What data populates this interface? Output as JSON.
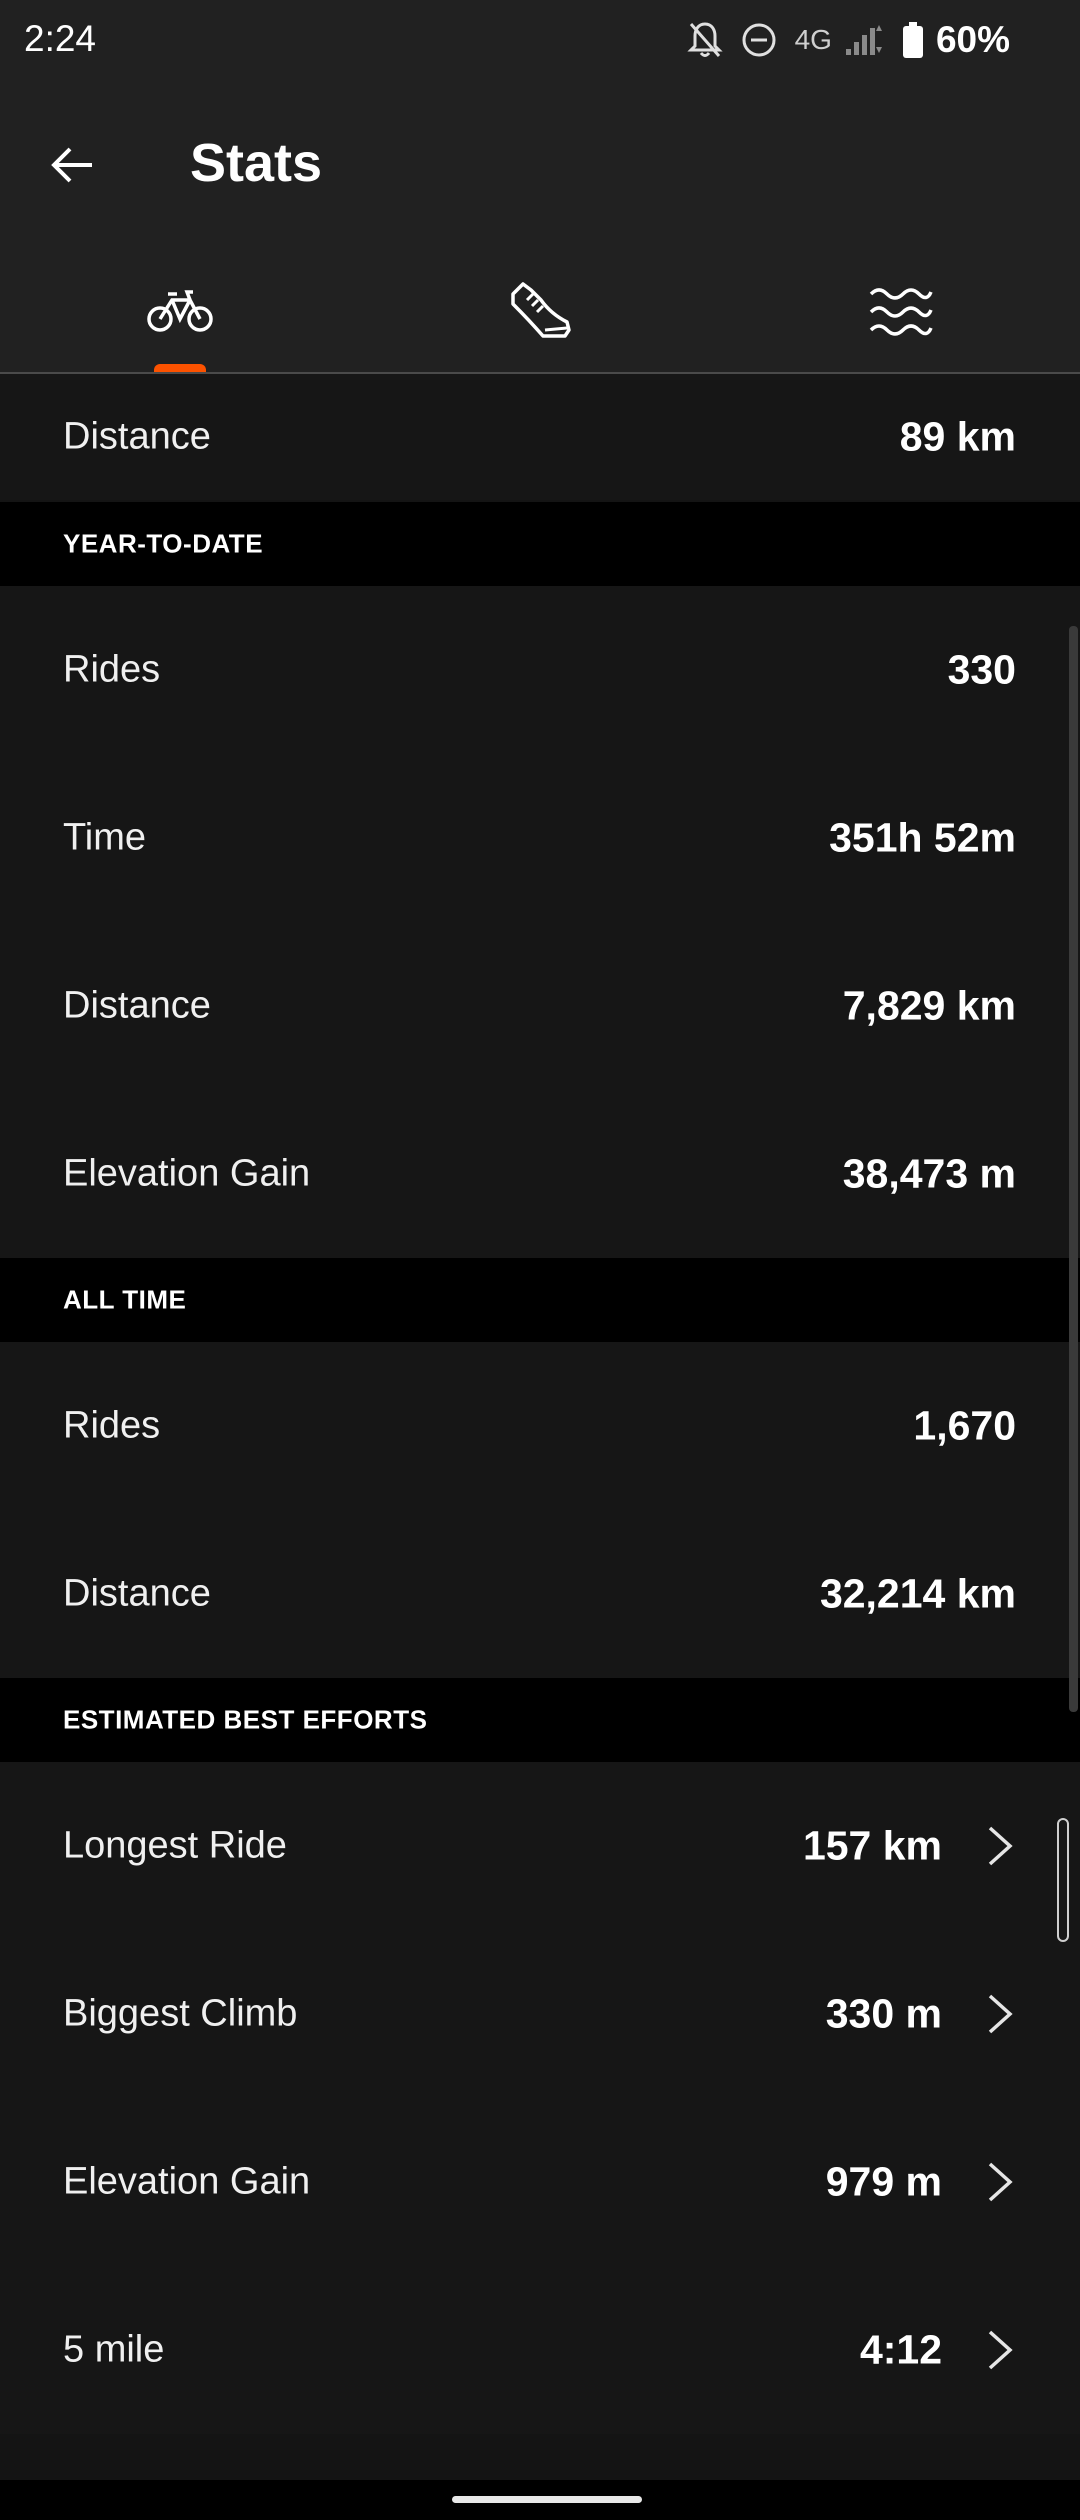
{
  "status_bar": {
    "time": "2:24",
    "network": "4G",
    "battery": "60%",
    "icons": [
      "notifications-off-icon",
      "do-not-disturb-icon",
      "signal-icon",
      "battery-icon"
    ]
  },
  "app_bar": {
    "title": "Stats",
    "back_icon": "arrow-left-icon"
  },
  "tabs": [
    {
      "name": "ride",
      "icon": "bike-icon",
      "selected": true
    },
    {
      "name": "run",
      "icon": "shoe-icon",
      "selected": false
    },
    {
      "name": "swim",
      "icon": "waves-icon",
      "selected": false
    }
  ],
  "colors": {
    "accent": "#fc5200",
    "background": "#161616",
    "header_bg": "#212121",
    "section_bg": "#000000"
  },
  "recent": {
    "distance_label": "Distance",
    "distance_value": "89 km"
  },
  "ytd": {
    "header": "YEAR-TO-DATE",
    "rows": [
      {
        "label": "Rides",
        "value": "330"
      },
      {
        "label": "Time",
        "value": "351h 52m"
      },
      {
        "label": "Distance",
        "value": "7,829 km"
      },
      {
        "label": "Elevation Gain",
        "value": "38,473 m"
      }
    ]
  },
  "all_time": {
    "header": "ALL TIME",
    "rows": [
      {
        "label": "Rides",
        "value": "1,670"
      },
      {
        "label": "Distance",
        "value": "32,214 km"
      }
    ]
  },
  "best_efforts": {
    "header": "ESTIMATED BEST EFFORTS",
    "rows": [
      {
        "label": "Longest Ride",
        "value": "157 km"
      },
      {
        "label": "Biggest Climb",
        "value": "330 m"
      },
      {
        "label": "Elevation Gain",
        "value": "979 m"
      },
      {
        "label": "5 mile",
        "value": "4:12"
      }
    ]
  }
}
